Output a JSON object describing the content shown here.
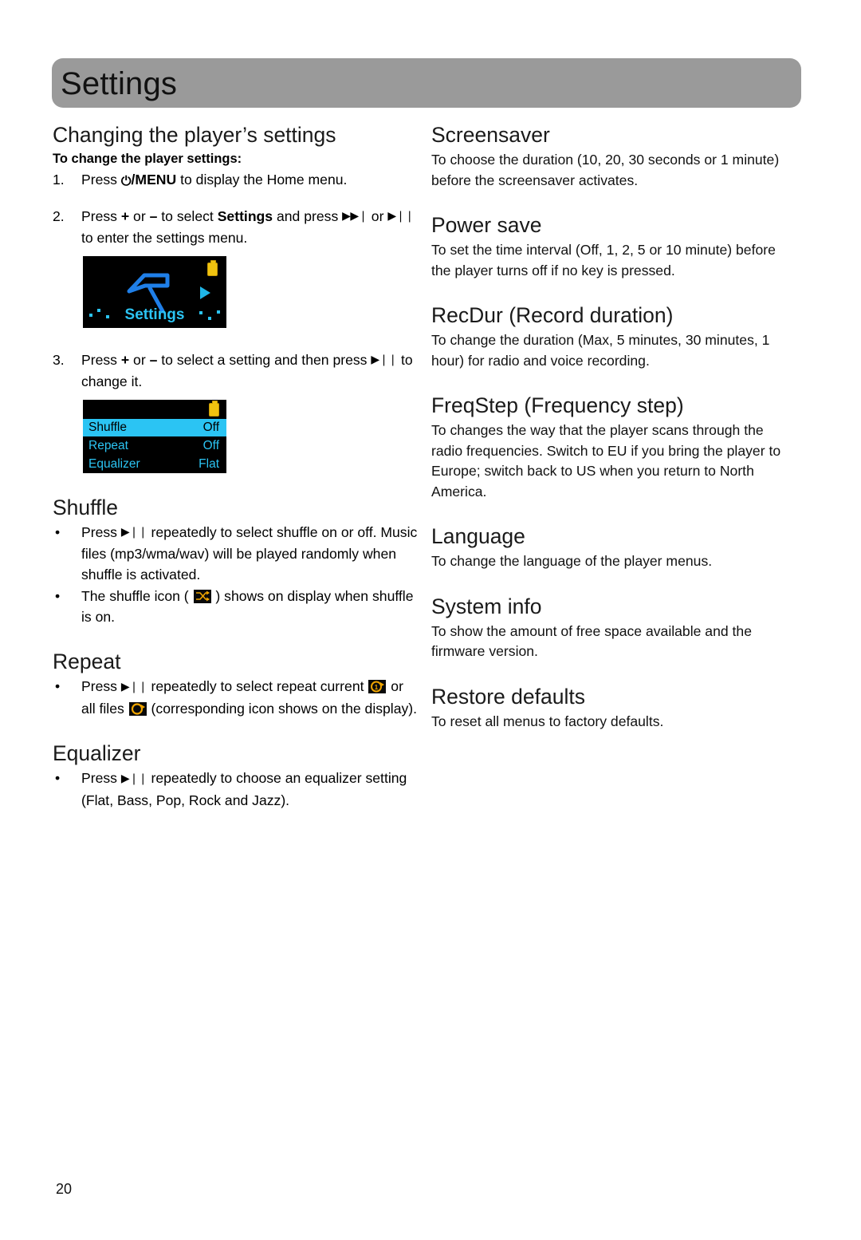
{
  "header": {
    "title": "Settings"
  },
  "left_column": {
    "section_title": "Changing the player’s settings",
    "subhead": "To change the player settings:",
    "steps": [
      {
        "marker": "1.",
        "parts": [
          {
            "t": "Press ",
            "b": false
          },
          {
            "t": "⏻/MENU",
            "b": true
          },
          {
            "t": " to display the Home menu.",
            "b": false
          }
        ]
      },
      {
        "marker": "2.",
        "parts": [
          {
            "t": "Press + or – to select ",
            "b": false
          },
          {
            "t": "Settings",
            "b": true
          },
          {
            "t": " and press ",
            "b": false
          },
          {
            "t": "▶▶❙",
            "b": false,
            "glyph": true
          },
          {
            "t": " or ",
            "b": false
          },
          {
            "t": "▶❙❙",
            "b": false,
            "glyph": true
          },
          {
            "t": " to enter the settings menu.",
            "b": false
          }
        ]
      },
      {
        "marker": "3.",
        "parts": [
          {
            "t": "Press + or – to select a setting and then press ",
            "b": false
          },
          {
            "t": "▶❙❙",
            "b": false,
            "glyph": true
          },
          {
            "t": " to change it.",
            "b": false
          }
        ]
      }
    ],
    "step1_text": "Press ⏻/MENU to display the Home menu.",
    "step2_text": "Press + or – to select Settings and press ▶▶❙ or ▶❙❙ to enter the settings menu.",
    "step3_text": "Press + or – to select a setting and then press ▶❙❙ to change it.",
    "home_screen": {
      "label": "Settings",
      "battery_icon": "battery-icon",
      "tool_icon": "hammer-icon",
      "arrow_icon": "play-arrow-icon",
      "battery_color": "#f0c310",
      "accent_color": "#2bc4f3"
    },
    "list_screen": {
      "battery_icon": "battery-icon",
      "rows": [
        {
          "label": "Shuffle",
          "value": "Off",
          "selected": true
        },
        {
          "label": "Repeat",
          "value": "Off",
          "selected": false
        },
        {
          "label": "Equalizer",
          "value": "Flat",
          "selected": false
        }
      ],
      "highlight_color": "#2bc4f3"
    },
    "sections": [
      {
        "title": "Shuffle",
        "bullets": [
          "Press ▶❙❙ repeatedly to select shuffle on or off. Music files (mp3/wma/wav) will be played randomly when shuffle is activated.",
          "The shuffle icon ( ■ ) shows on display when shuffle is on."
        ]
      },
      {
        "title": "Repeat",
        "bullets": [
          "Press ▶❙❙ repeatedly to select repeat current ■ or all files ■ (corresponding icon shows on the display)."
        ]
      },
      {
        "title": "Equalizer",
        "bullets": [
          "Press ▶❙❙ repeatedly to choose an equalizer setting (Flat, Bass, Pop, Rock and Jazz)."
        ]
      }
    ],
    "shuffle": {
      "title": "Shuffle",
      "bullet1_a": "Press ",
      "bullet1_b": " repeatedly to select shuffle on or off. Music files (mp3/wma/wav) will be played randomly when shuffle is activated.",
      "bullet2_a": "The shuffle icon ( ",
      "bullet2_b": " ) shows on display when shuffle is on.",
      "icon_name": "shuffle-icon"
    },
    "repeat": {
      "title": "Repeat",
      "bullet_a": "Press ",
      "bullet_b": " repeatedly to select repeat current ",
      "bullet_c": " or all files ",
      "bullet_d": " (corresponding icon shows on the display).",
      "icon_one_name": "repeat-one-icon",
      "icon_all_name": "repeat-all-icon"
    },
    "equalizer": {
      "title": "Equalizer",
      "bullet_a": "Press ",
      "bullet_b": " repeatedly to choose an equalizer setting (Flat, Bass, Pop, Rock and Jazz)."
    }
  },
  "right_column": [
    {
      "title": "Screensaver",
      "body": "To choose the duration (10, 20, 30 seconds or 1 minute) before the screensaver activates."
    },
    {
      "title": "Power save",
      "body": "To set the time interval (Off, 1, 2, 5 or 10 minute) before the player turns off if no key is pressed."
    },
    {
      "title": "RecDur (Record duration)",
      "body": "To change the duration (Max, 5 minutes, 30 minutes, 1 hour) for radio and voice recording."
    },
    {
      "title": "FreqStep (Frequency step)",
      "body": "To changes the way that the player scans through the radio frequencies. Switch to EU if you bring the player to Europe; switch back to US when you return to North America."
    },
    {
      "title": "Language",
      "body": "To change the language of the player menus."
    },
    {
      "title": "System info",
      "body": "To show the amount of free space available and the firmware version."
    },
    {
      "title": "Restore defaults",
      "body": "To reset all menus to factory defaults."
    }
  ],
  "footer": {
    "page_number": "20"
  },
  "colors": {
    "header_bar": "#9a9a9a",
    "screen_accent": "#2bc4f3",
    "icon_orange": "#f0a500",
    "battery_yellow": "#f0c310"
  }
}
